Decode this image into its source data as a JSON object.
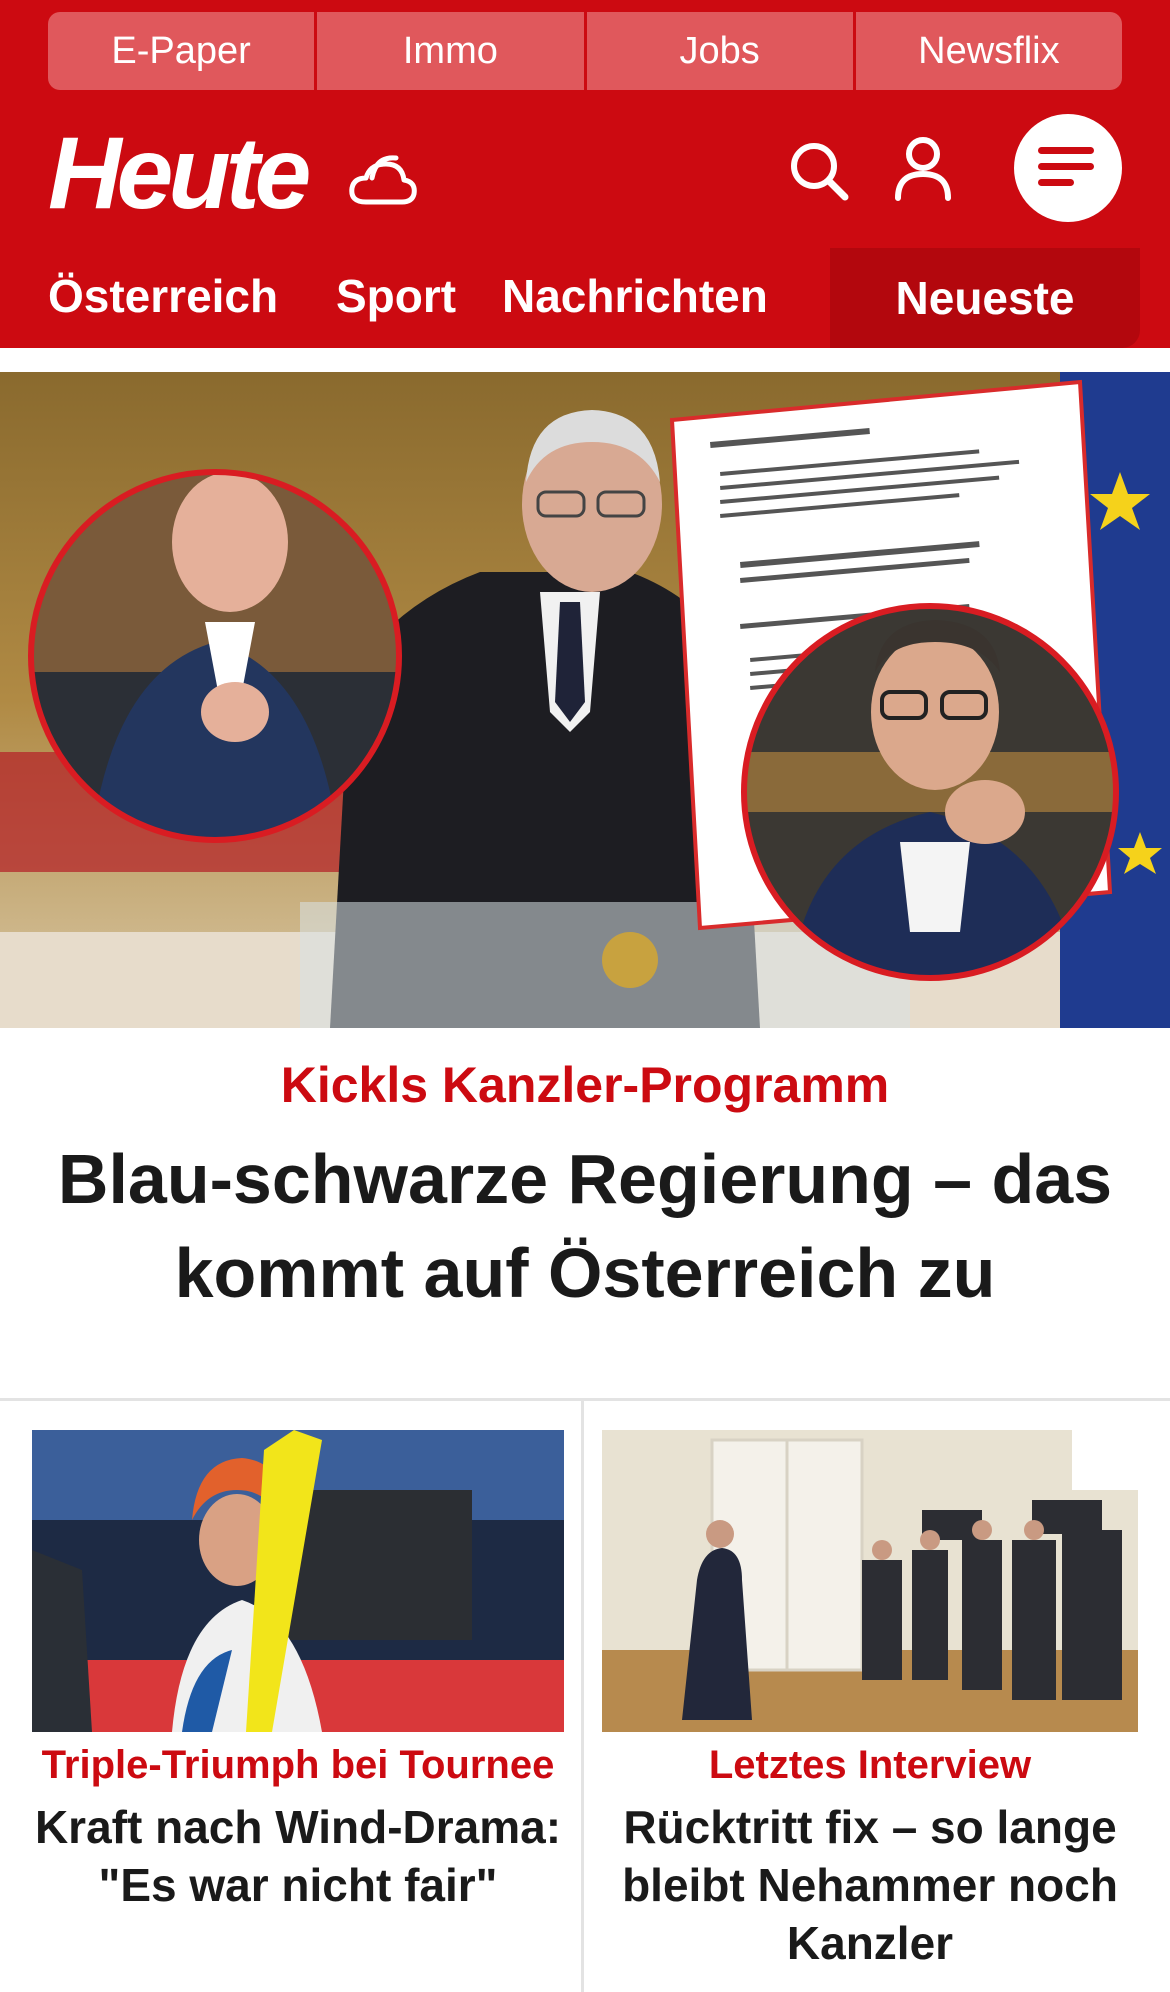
{
  "topnav": {
    "items": [
      "E-Paper",
      "Immo",
      "Jobs",
      "Newsflix"
    ]
  },
  "brand": {
    "logo_text": "Heute",
    "icons": [
      "weather-cloud-icon",
      "search-icon",
      "user-icon",
      "menu-icon"
    ]
  },
  "secnav": {
    "items": [
      "Österreich",
      "Sport",
      "Nachrichten"
    ],
    "active": "Neueste"
  },
  "hero": {
    "kicker": "Kickls Kanzler-Programm",
    "headline": "Blau-schwarze Regierung – das kommt auf Österreich zu"
  },
  "cards": [
    {
      "kicker": "Triple-Triumph bei Tournee",
      "title": "Kraft nach Wind-Drama: \"Es war nicht fair\""
    },
    {
      "kicker": "Letztes Interview",
      "title": "Rücktritt fix – so lange bleibt Nehammer noch Kanzler"
    }
  ],
  "colors": {
    "brand_red": "#cc0a11",
    "topnav_bg": "#e0585c",
    "active_tab_bg": "#b3070d",
    "text_dark": "#1a1a1a"
  }
}
